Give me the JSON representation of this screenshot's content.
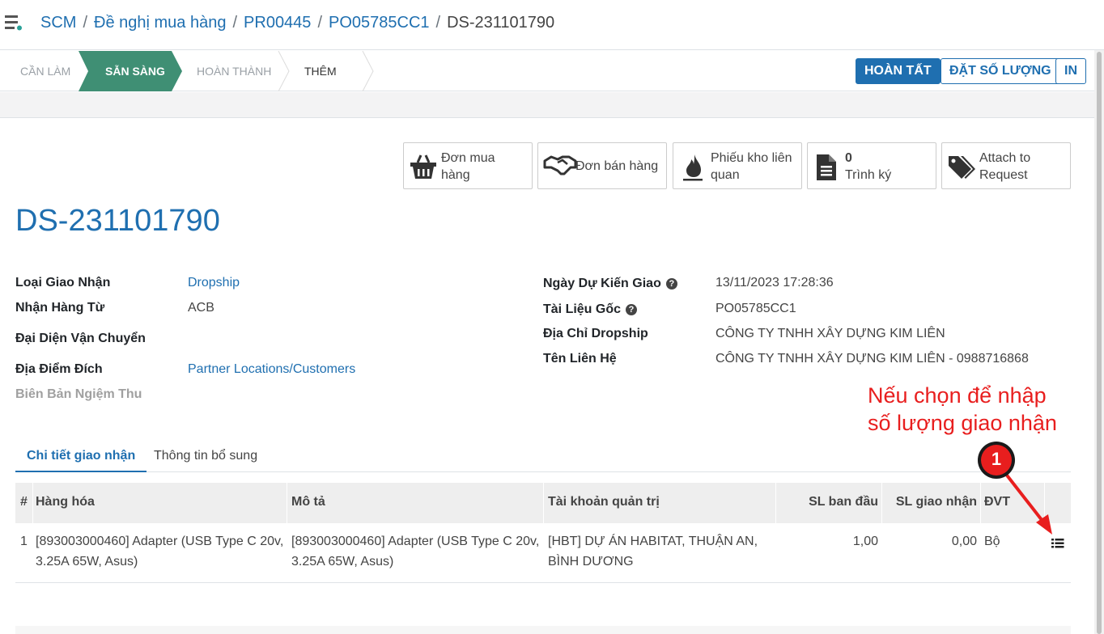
{
  "breadcrumb": {
    "items": [
      "SCM",
      "Đề nghị mua hàng",
      "PR00445",
      "PO05785CC1"
    ],
    "current": "DS-231101790"
  },
  "status": {
    "stages": [
      "CẦN LÀM",
      "SẴN SÀNG",
      "HOÀN THÀNH",
      "THÊM"
    ],
    "active_stage": "SẴN SÀNG"
  },
  "actions": {
    "done": "HOÀN TẤT",
    "set_quantity": "ĐẶT SỐ LƯỢNG",
    "print": "IN"
  },
  "smart_buttons": {
    "purchase_order": {
      "line1": "Đơn mua",
      "line2": "hàng",
      "icon": "basket-icon"
    },
    "sales_order": {
      "line1": "Đơn bán hàng",
      "icon": "handshake-icon"
    },
    "related_pickings": {
      "line1": "Phiếu kho liên",
      "line2": "quan",
      "icon": "flame-icon"
    },
    "approvals": {
      "line1": "0",
      "line2": "Trình ký",
      "icon": "document-icon"
    },
    "attach": {
      "line1": "Attach to",
      "line2": "Request",
      "icon": "tags-icon"
    }
  },
  "record": {
    "title": "DS-231101790"
  },
  "fields_left": {
    "operation_type": {
      "label": "Loại Giao Nhận",
      "value": "Dropship"
    },
    "receive_from": {
      "label": "Nhận Hàng Từ",
      "value": "ACB"
    },
    "carrier": {
      "label": "Đại Diện Vận Chuyển",
      "value": ""
    },
    "destination": {
      "label": "Địa Điểm Đích",
      "value": "Partner Locations/Customers"
    },
    "acceptance": {
      "label": "Biên Bản Ngiệm Thu",
      "value": ""
    }
  },
  "fields_right": {
    "scheduled_date": {
      "label": "Ngày Dự Kiến Giao",
      "value": "13/11/2023 17:28:36",
      "help": "?"
    },
    "source_document": {
      "label": "Tài Liệu Gốc",
      "value": "PO05785CC1",
      "help": "?"
    },
    "dropship_address": {
      "label": "Địa Chỉ Dropship",
      "value": "CÔNG TY TNHH XÂY DỰNG KIM LIÊN"
    },
    "contact_name": {
      "label": "Tên Liên Hệ",
      "value": "CÔNG TY TNHH XÂY DỰNG KIM LIÊN - 0988716868"
    }
  },
  "annotation": {
    "line1": "Nếu chọn để nhập",
    "line2": "số lượng giao nhận",
    "marker": "1"
  },
  "tabs": {
    "details": "Chi tiết giao nhận",
    "extra": "Thông tin bổ sung"
  },
  "table": {
    "headers": {
      "index": "#",
      "product": "Hàng hóa",
      "description": "Mô tả",
      "account": "Tài khoản quản trị",
      "initial_qty": "SL ban đầu",
      "done_qty": "SL giao nhận",
      "uom": "ĐVT"
    },
    "rows": [
      {
        "index": "1",
        "product_line1": "[893003000460] Adapter (USB Type C 20v,",
        "product_line2": "3.25A 65W, Asus)",
        "description_line1": "[893003000460] Adapter (USB Type C 20v,",
        "description_line2": "3.25A 65W, Asus)",
        "account_line1": "[HBT] DỰ ÁN HABITAT, THUẬN AN,",
        "account_line2": "BÌNH DƯƠNG",
        "initial_qty": "1,00",
        "done_qty": "0,00",
        "uom": "Bộ",
        "action_icon": "list-details-icon"
      }
    ]
  },
  "colors": {
    "brand": "#1f6fb0",
    "active_stage": "#3f8f74",
    "annotation": "#e81e1e"
  }
}
